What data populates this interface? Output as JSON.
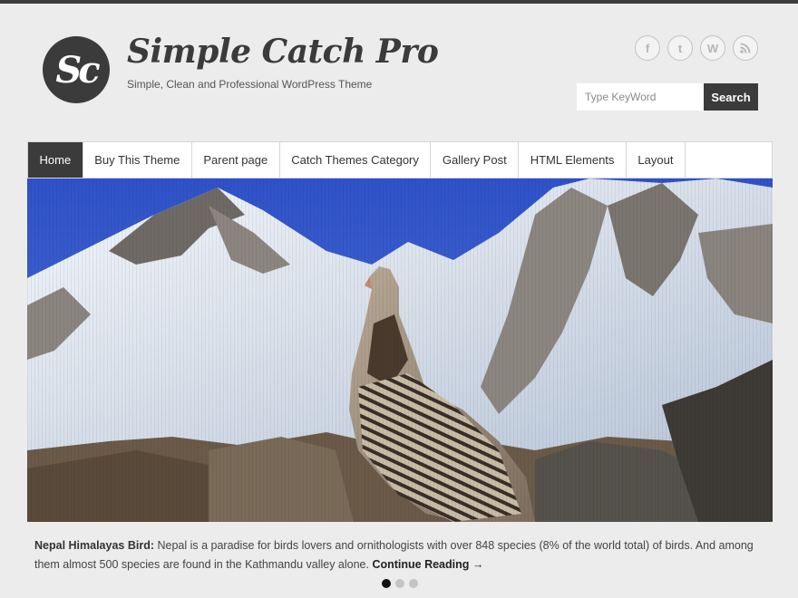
{
  "header": {
    "logo_text": "Sc",
    "title": "Simple Catch Pro",
    "tagline": "Simple, Clean and Professional WordPress Theme",
    "social": [
      {
        "name": "facebook-icon",
        "glyph": "f"
      },
      {
        "name": "twitter-icon",
        "glyph": "t"
      },
      {
        "name": "wordpress-icon",
        "glyph": "W"
      },
      {
        "name": "rss-icon",
        "glyph": "rss"
      }
    ],
    "search": {
      "placeholder": "Type KeyWord",
      "button": "Search"
    }
  },
  "nav": {
    "items": [
      {
        "label": "Home",
        "active": true
      },
      {
        "label": "Buy This Theme"
      },
      {
        "label": "Parent page"
      },
      {
        "label": "Catch Themes Category"
      },
      {
        "label": "Gallery Post"
      },
      {
        "label": "HTML Elements"
      },
      {
        "label": "Layout"
      }
    ]
  },
  "slider": {
    "caption_title": "Nepal Himalayas Bird:",
    "caption_text": " Nepal is a paradise for birds lovers and ornithologists with over 848 species (8% of the world total) of birds. And among them almost 500 species are found in the Kathmandu valley alone. ",
    "read_more": "Continue Reading →",
    "dot_count": 3,
    "active_dot": 0
  },
  "colors": {
    "accent": "#3b3b3b",
    "background": "#ececec"
  }
}
